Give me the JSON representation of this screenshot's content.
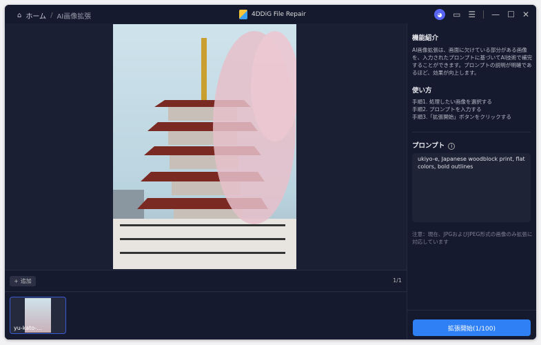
{
  "titlebar": {
    "home": "ホーム",
    "separator": "/",
    "current": "AI画像拡張",
    "app_title": "4DDiG File Repair"
  },
  "toolbar": {
    "add_label": "追加",
    "page_count": "1/1"
  },
  "thumbnails": [
    {
      "label": "yu-kato-..."
    }
  ],
  "panel": {
    "intro_title": "機能紹介",
    "intro_text": "AI画像拡張は、画面に欠けている部分がある画像を、入力されたプロンプトに基づいてAI技術で補完することができます。プロンプトの説明が明確であるほど、効果が向上します。",
    "howto_title": "使い方",
    "steps": [
      "手順1. 処理したい画像を選択する",
      "手順2. プロンプトを入力する",
      "手順3.「拡張開始」ボタンをクリックする"
    ],
    "prompt_title": "プロンプト",
    "prompt_value": "ukiyo-e, Japanese woodblock print, flat colors, bold outlines",
    "note": "注意：現在、JPGおよびJPEG形式の画像のみ拡張に対応しています",
    "start_label": "拡張開始(1/100)"
  },
  "colors": {
    "accent": "#2f80f5",
    "background": "#161a2e"
  }
}
